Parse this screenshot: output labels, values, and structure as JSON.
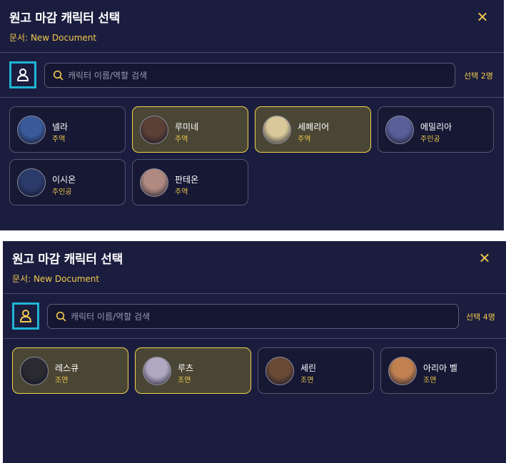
{
  "panels": [
    {
      "title": "원고 마감 캐릭터 선택",
      "doc_label": "문서: New Document",
      "search_placeholder": "캐릭터 이름/역할 검색",
      "selection_count": "선택 2명",
      "characters": [
        {
          "name": "넬라",
          "role": "주역",
          "selected": false,
          "color": "#3a5a9a"
        },
        {
          "name": "루미네",
          "role": "주역",
          "selected": true,
          "color": "#5a4035"
        },
        {
          "name": "세페리어",
          "role": "주역",
          "selected": true,
          "color": "#d8c89a"
        },
        {
          "name": "에밀리아",
          "role": "주인공",
          "selected": false,
          "color": "#5a5f9a"
        },
        {
          "name": "이시온",
          "role": "주인공",
          "selected": false,
          "color": "#2a3a6a"
        },
        {
          "name": "판테온",
          "role": "주역",
          "selected": false,
          "color": "#b08a80"
        }
      ]
    },
    {
      "title": "원고 마감 캐릭터 선택",
      "doc_label": "문서: New Document",
      "search_placeholder": "캐릭터 이름/역할 검색",
      "selection_count": "선택 4명",
      "characters": [
        {
          "name": "레스큐",
          "role": "조연",
          "selected": true,
          "color": "#2a2a30"
        },
        {
          "name": "루츠",
          "role": "조연",
          "selected": true,
          "color": "#b0a8c0"
        },
        {
          "name": "세린",
          "role": "조연",
          "selected": false,
          "color": "#6a4a35"
        },
        {
          "name": "아리아 벨",
          "role": "조연",
          "selected": false,
          "color": "#c08050"
        }
      ]
    }
  ],
  "colors": {
    "background": "#1b1d3f",
    "accent": "#f2c94c",
    "highlight_border": "#1fb5d6",
    "selected_card": "#4a4635"
  },
  "icons": {
    "close": "close-icon",
    "person": "person-icon",
    "search": "search-icon"
  }
}
